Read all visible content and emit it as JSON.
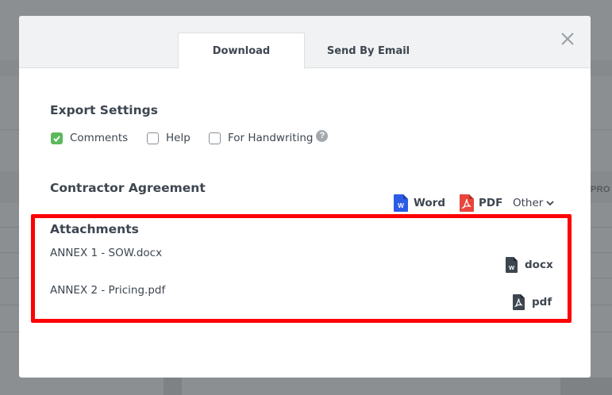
{
  "tabs": {
    "download": "Download",
    "email": "Send By Email"
  },
  "export_settings": {
    "title": "Export Settings",
    "options": [
      {
        "label": "Comments",
        "checked": true
      },
      {
        "label": "Help",
        "checked": false
      },
      {
        "label": "For Handwriting",
        "checked": false
      }
    ],
    "help_glyph": "?"
  },
  "document": {
    "title": "Contractor Agreement",
    "formats": {
      "word": "Word",
      "pdf": "PDF",
      "other": "Other"
    }
  },
  "attachments": {
    "title": "Attachments",
    "files": [
      {
        "name": "ANNEX 1 - SOW.docx",
        "format": "docx",
        "icon": "word-file-icon"
      },
      {
        "name": "ANNEX 2 - Pricing.pdf",
        "format": "pdf",
        "icon": "pdf-file-icon"
      }
    ]
  },
  "background": {
    "column_header_fragment": "PRO"
  },
  "colors": {
    "highlight_border": "#ff0000",
    "checkbox_checked": "#5cb85c",
    "word_blue": "#2b5ce6",
    "pdf_red": "#e8453c",
    "overlay": "#8c8f92"
  }
}
